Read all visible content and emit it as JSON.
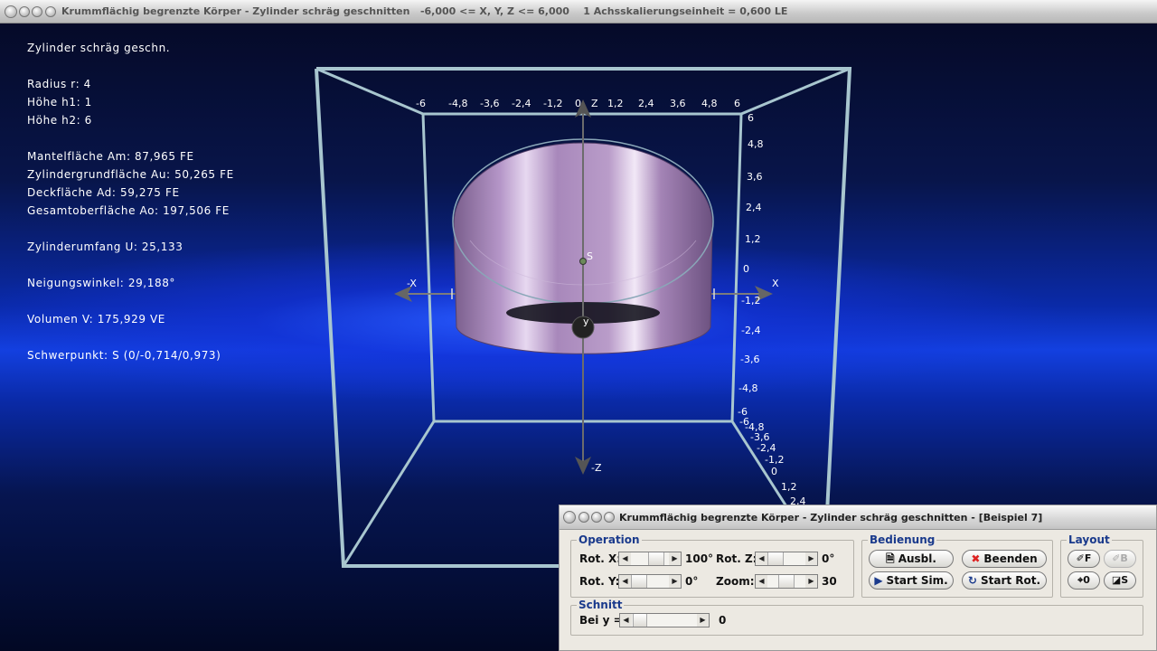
{
  "main_window": {
    "title": "Krummflächig begrenzte Körper - Zylinder schräg geschnitten   -6,000 <= X, Y, Z <= 6,000    1 Achsskalierungseinheit = 0,600 LE"
  },
  "info": {
    "heading": "Zylinder schräg geschn.",
    "radius": "Radius r: 4",
    "hoehe_h1": "Höhe h1: 1",
    "hoehe_h2": "Höhe h2: 6",
    "mantelflaeche": "Mantelfläche Am: 87,965 FE",
    "grundflaeche": "Zylindergrundfläche Au: 50,265 FE",
    "deckflaeche": "Deckfläche Ad: 59,275 FE",
    "gesamtoberflaeche": "Gesamtoberfläche Ao: 197,506 FE",
    "umfang": "Zylinderumfang U: 25,133",
    "neigungswinkel": "Neigungswinkel: 29,188°",
    "volumen": "Volumen V: 175,929 VE",
    "schwerpunkt": "Schwerpunkt: S (0/-0,714/0,973)"
  },
  "scene": {
    "x_ticks": [
      "-6",
      "-4,8",
      "-3,6",
      "-2,4",
      "-1,2",
      "0",
      "1,2",
      "2,4",
      "3,6",
      "4,8",
      "6"
    ],
    "z_label": "Z",
    "z_ticks": [
      "6",
      "4,8",
      "3,6",
      "2,4",
      "1,2",
      "0",
      "-1,2",
      "-2,4",
      "-3,6",
      "-4,8",
      "-6"
    ],
    "diag_ticks": [
      "-6",
      "-4,8",
      "-3,6",
      "-2,4",
      "-1,2",
      "0",
      "1,2",
      "2,4"
    ],
    "x_pos_label": "X",
    "x_neg_label": "-X",
    "z_neg_label": "-Z",
    "centroid_label": "S",
    "y_label": "y"
  },
  "dialog": {
    "title": "Krummflächig begrenzte Körper - Zylinder schräg geschnitten - [Beispiel 7]",
    "operation": {
      "legend": "Operation",
      "rot_x_label": "Rot. X:",
      "rot_x_value": "100°",
      "rot_y_label": "Rot. Y:",
      "rot_y_value": "0°",
      "rot_z_label": "Rot. Z:",
      "rot_z_value": "0°",
      "zoom_label": "Zoom:",
      "zoom_value": "30"
    },
    "bedienung": {
      "legend": "Bedienung",
      "ausbl": "Ausbl.",
      "beenden": "Beenden",
      "start_sim": "Start Sim.",
      "start_rot": "Start Rot."
    },
    "layout": {
      "legend": "Layout",
      "f": "F",
      "b": "B",
      "o": "0",
      "s": "S"
    },
    "schnitt": {
      "legend": "Schnitt",
      "bei_y_label": "Bei y =",
      "bei_y_value": "0"
    }
  },
  "colors": {
    "background_blue": "#1340e0",
    "cylinder": "#b38fc4",
    "frame": "#a8c6cf",
    "legend_text": "#1a3a8c"
  }
}
